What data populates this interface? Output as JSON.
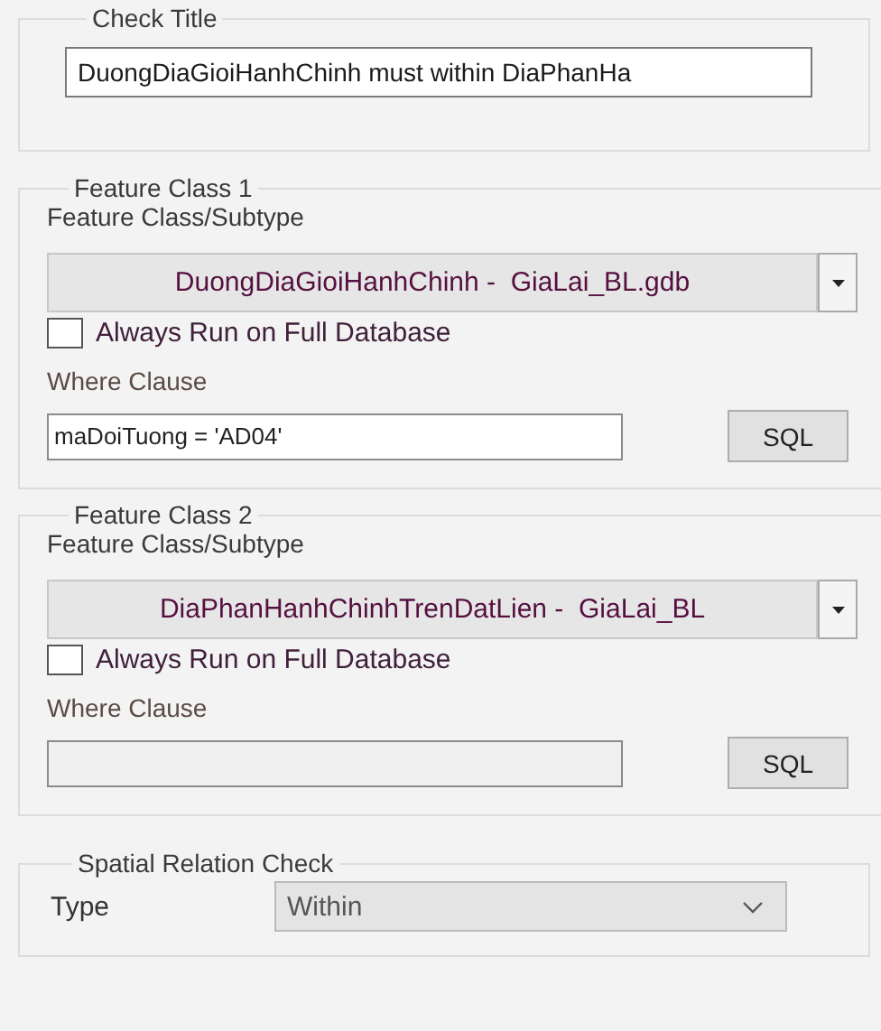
{
  "check_title": {
    "legend": "Check Title",
    "value": "DuongDiaGioiHanhChinh must within DiaPhanHa"
  },
  "feature_classes": [
    {
      "legend": "Feature Class 1",
      "subtype_label": "Feature Class/Subtype",
      "subtype_value": "DuongDiaGioiHanhChinh -  GiaLai_BL.gdb",
      "always_run": {
        "label": "Always Run on Full Database",
        "checked": false
      },
      "where_label": "Where Clause",
      "where_value": "maDoiTuong = 'AD04'",
      "sql_button": "SQL"
    },
    {
      "legend": "Feature Class 2",
      "subtype_label": "Feature Class/Subtype",
      "subtype_value": "DiaPhanHanhChinhTrenDatLien -  GiaLai_BL",
      "always_run": {
        "label": "Always Run on Full Database",
        "checked": false
      },
      "where_label": "Where Clause",
      "sql_button": "SQL"
    }
  ],
  "spatial_relation": {
    "legend": "Spatial Relation Check",
    "type_label": "Type",
    "type_value": "Within"
  }
}
